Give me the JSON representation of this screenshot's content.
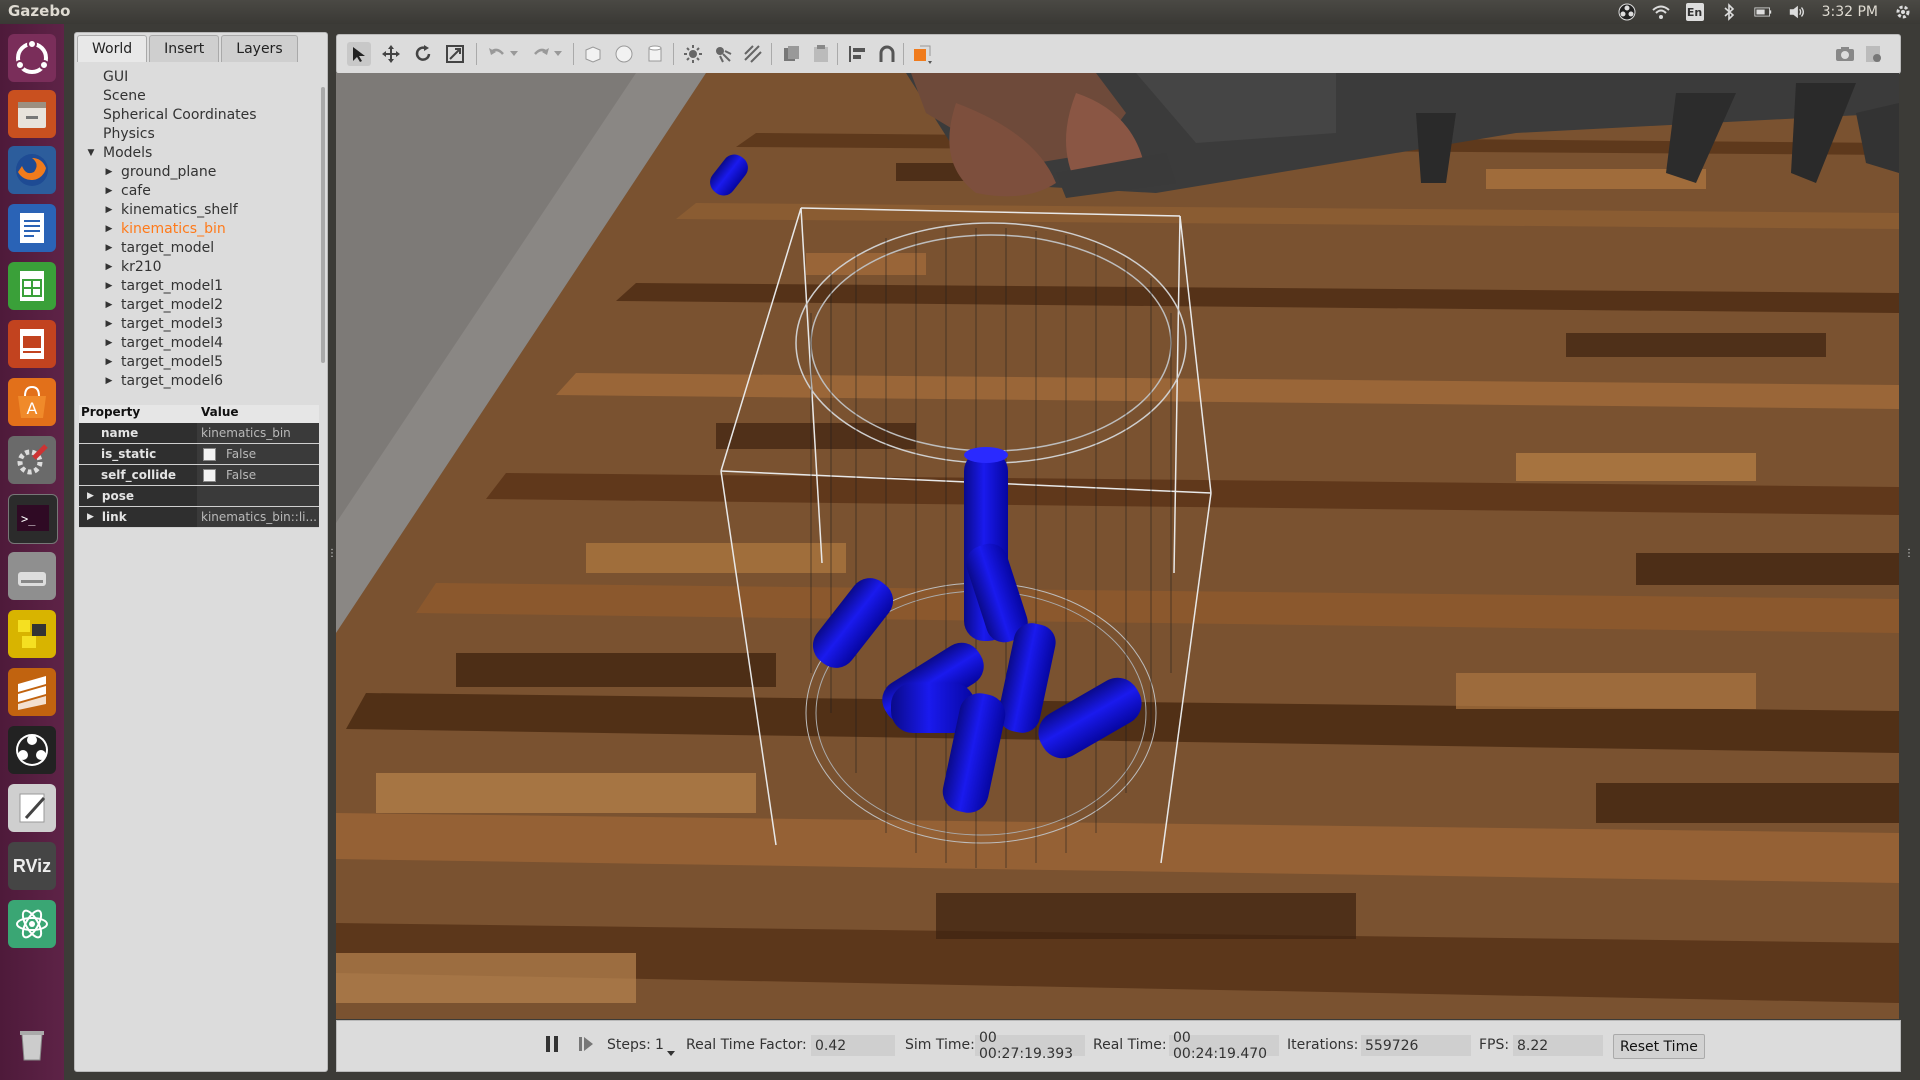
{
  "top_bar": {
    "app_title": "Gazebo",
    "keyboard_indicator": "En",
    "clock": "3:32 PM",
    "icons": [
      "obs-tray-icon",
      "wifi-icon",
      "keyboard-layout-icon",
      "bluetooth-icon",
      "battery-icon",
      "volume-icon",
      "settings-gear-icon"
    ]
  },
  "launcher": {
    "items": [
      "ubuntu-dash-icon",
      "files-icon",
      "firefox-icon",
      "writer-icon",
      "calc-icon",
      "impress-icon",
      "software-center-icon",
      "system-settings-icon",
      "terminal-icon",
      "disk-icon",
      "puzzle-app-icon",
      "sublime-icon",
      "obs-icon",
      "text-editor-icon",
      "rviz-icon",
      "atom-icon",
      "trash-icon"
    ],
    "rviz_label": "RViz"
  },
  "left_panel": {
    "tabs": [
      {
        "label": "World",
        "active": true
      },
      {
        "label": "Insert",
        "active": false
      },
      {
        "label": "Layers",
        "active": false
      }
    ],
    "tree": {
      "top_items": [
        "GUI",
        "Scene",
        "Spherical Coordinates",
        "Physics"
      ],
      "models_label": "Models",
      "models": [
        "ground_plane",
        "cafe",
        "kinematics_shelf",
        "kinematics_bin",
        "target_model",
        "kr210",
        "target_model1",
        "target_model2",
        "target_model3",
        "target_model4",
        "target_model5",
        "target_model6"
      ],
      "selected": "kinematics_bin"
    },
    "properties": {
      "header_property": "Property",
      "header_value": "Value",
      "rows": [
        {
          "name": "name",
          "value": "kinematics_bin"
        },
        {
          "name": "is_static",
          "value": "False",
          "checkbox": true
        },
        {
          "name": "self_collide",
          "value": "False",
          "checkbox": true
        },
        {
          "name": "pose",
          "value": "",
          "group": true
        },
        {
          "name": "link",
          "value": "kinematics_bin::li...",
          "group": true
        }
      ]
    }
  },
  "toolbar": {
    "icons": [
      "select-arrow-icon",
      "translate-icon",
      "rotate-icon",
      "scale-icon",
      "undo-icon",
      "undo-dropdown-icon",
      "redo-icon",
      "redo-dropdown-icon",
      "box-shape-icon",
      "sphere-shape-icon",
      "cylinder-shape-icon",
      "point-light-icon",
      "spot-light-icon",
      "directional-light-icon",
      "copy-icon",
      "paste-icon",
      "align-icon",
      "snap-icon",
      "view-angle-icon",
      "screenshot-icon",
      "log-icon"
    ]
  },
  "status": {
    "steps_label": "Steps:",
    "steps_value": "1",
    "rtf_label": "Real Time Factor:",
    "rtf_value": "0.42",
    "sim_time_label": "Sim Time:",
    "sim_time_value": "00 00:27:19.393",
    "real_time_label": "Real Time:",
    "real_time_value": "00 00:24:19.470",
    "iterations_label": "Iterations:",
    "iterations_value": "559726",
    "fps_label": "FPS:",
    "fps_value": "8.22",
    "reset_label": "Reset Time"
  },
  "colors": {
    "launcher": "#5e2347",
    "selected_model": "#ff7a1a",
    "cylinders": "#1010cc",
    "floor": "#6a4424"
  }
}
